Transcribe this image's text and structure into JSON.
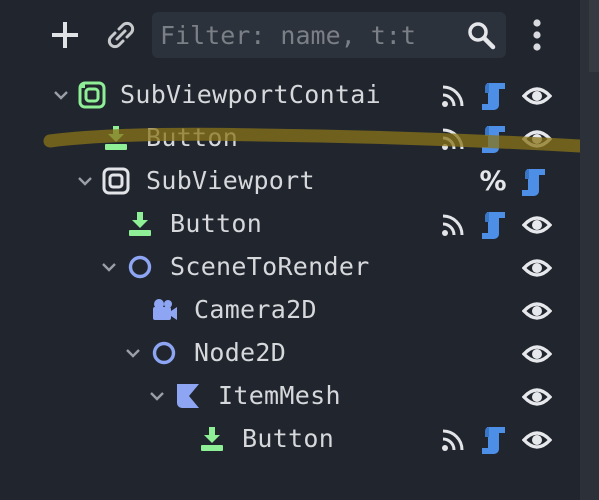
{
  "toolbar": {
    "add_icon": "plus-icon",
    "link_icon": "chain-link-icon",
    "filter_placeholder": "Filter: name, t:t",
    "search_icon": "magnifier-icon",
    "menu_icon": "kebab-menu-icon"
  },
  "tree": {
    "nodes": [
      {
        "label": "SubViewportContai",
        "type_icon": "subviewport-container-icon",
        "expanded": true,
        "signal": true,
        "script": true,
        "visible": true
      },
      {
        "label": "Button",
        "type_icon": "button-icon",
        "signal": true,
        "script": true,
        "visible": true
      },
      {
        "label": "SubViewport",
        "type_icon": "subviewport-icon",
        "expanded": true,
        "unique_name_marker": "%",
        "script": true
      },
      {
        "label": "Button",
        "type_icon": "button-icon",
        "signal": true,
        "script": true,
        "visible": true
      },
      {
        "label": "SceneToRender",
        "type_icon": "node2d-icon",
        "expanded": true,
        "visible": true
      },
      {
        "label": "Camera2D",
        "type_icon": "camera2d-icon",
        "visible": true
      },
      {
        "label": "Node2D",
        "type_icon": "node2d-icon",
        "expanded": true,
        "visible": true
      },
      {
        "label": "ItemMesh",
        "type_icon": "mesh-instance-2d-icon",
        "expanded": true,
        "visible": true
      },
      {
        "label": "Button",
        "type_icon": "button-icon",
        "signal": true,
        "script": true,
        "visible": true
      }
    ]
  },
  "colors": {
    "panel_bg": "#21262e",
    "text": "#d6d8dc",
    "control_green": "#8eef97",
    "node2d_blue": "#8da5f3",
    "script_blue": "#4d8ee6",
    "highlight_stroke": "#8a7418"
  }
}
